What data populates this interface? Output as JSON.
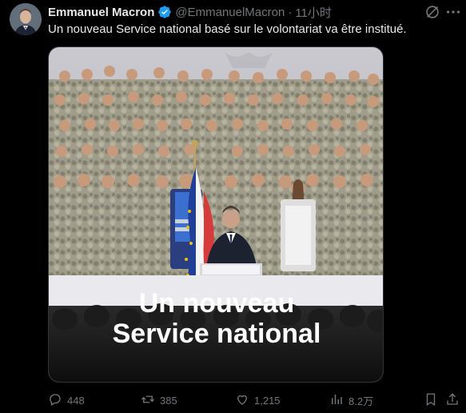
{
  "author": {
    "display_name": "Emmanuel Macron",
    "handle": "@EmmanuelMacron",
    "separator": "·",
    "time": "11小时"
  },
  "tweet": {
    "text": "Un nouveau Service national basé sur le volontariat va être institué."
  },
  "media": {
    "caption_line1": "Un nouveau",
    "caption_line2": "Service national"
  },
  "actions": {
    "replies": "448",
    "reposts": "385",
    "likes": "1,215",
    "views": "8.2万"
  },
  "colors": {
    "background": "#000000",
    "text_primary": "#e7e9ea",
    "text_secondary": "#71767b",
    "verified_badge": "#1d9bf0",
    "flag_blue": "#1f3f9a",
    "flag_red": "#d63a3a"
  },
  "icons": {
    "verified": "verified-badge-icon",
    "grok": "grok-icon",
    "more": "more-options-icon",
    "reply": "reply-icon",
    "repost": "repost-icon",
    "like": "like-icon",
    "views": "views-icon",
    "bookmark": "bookmark-icon",
    "share": "share-icon"
  }
}
